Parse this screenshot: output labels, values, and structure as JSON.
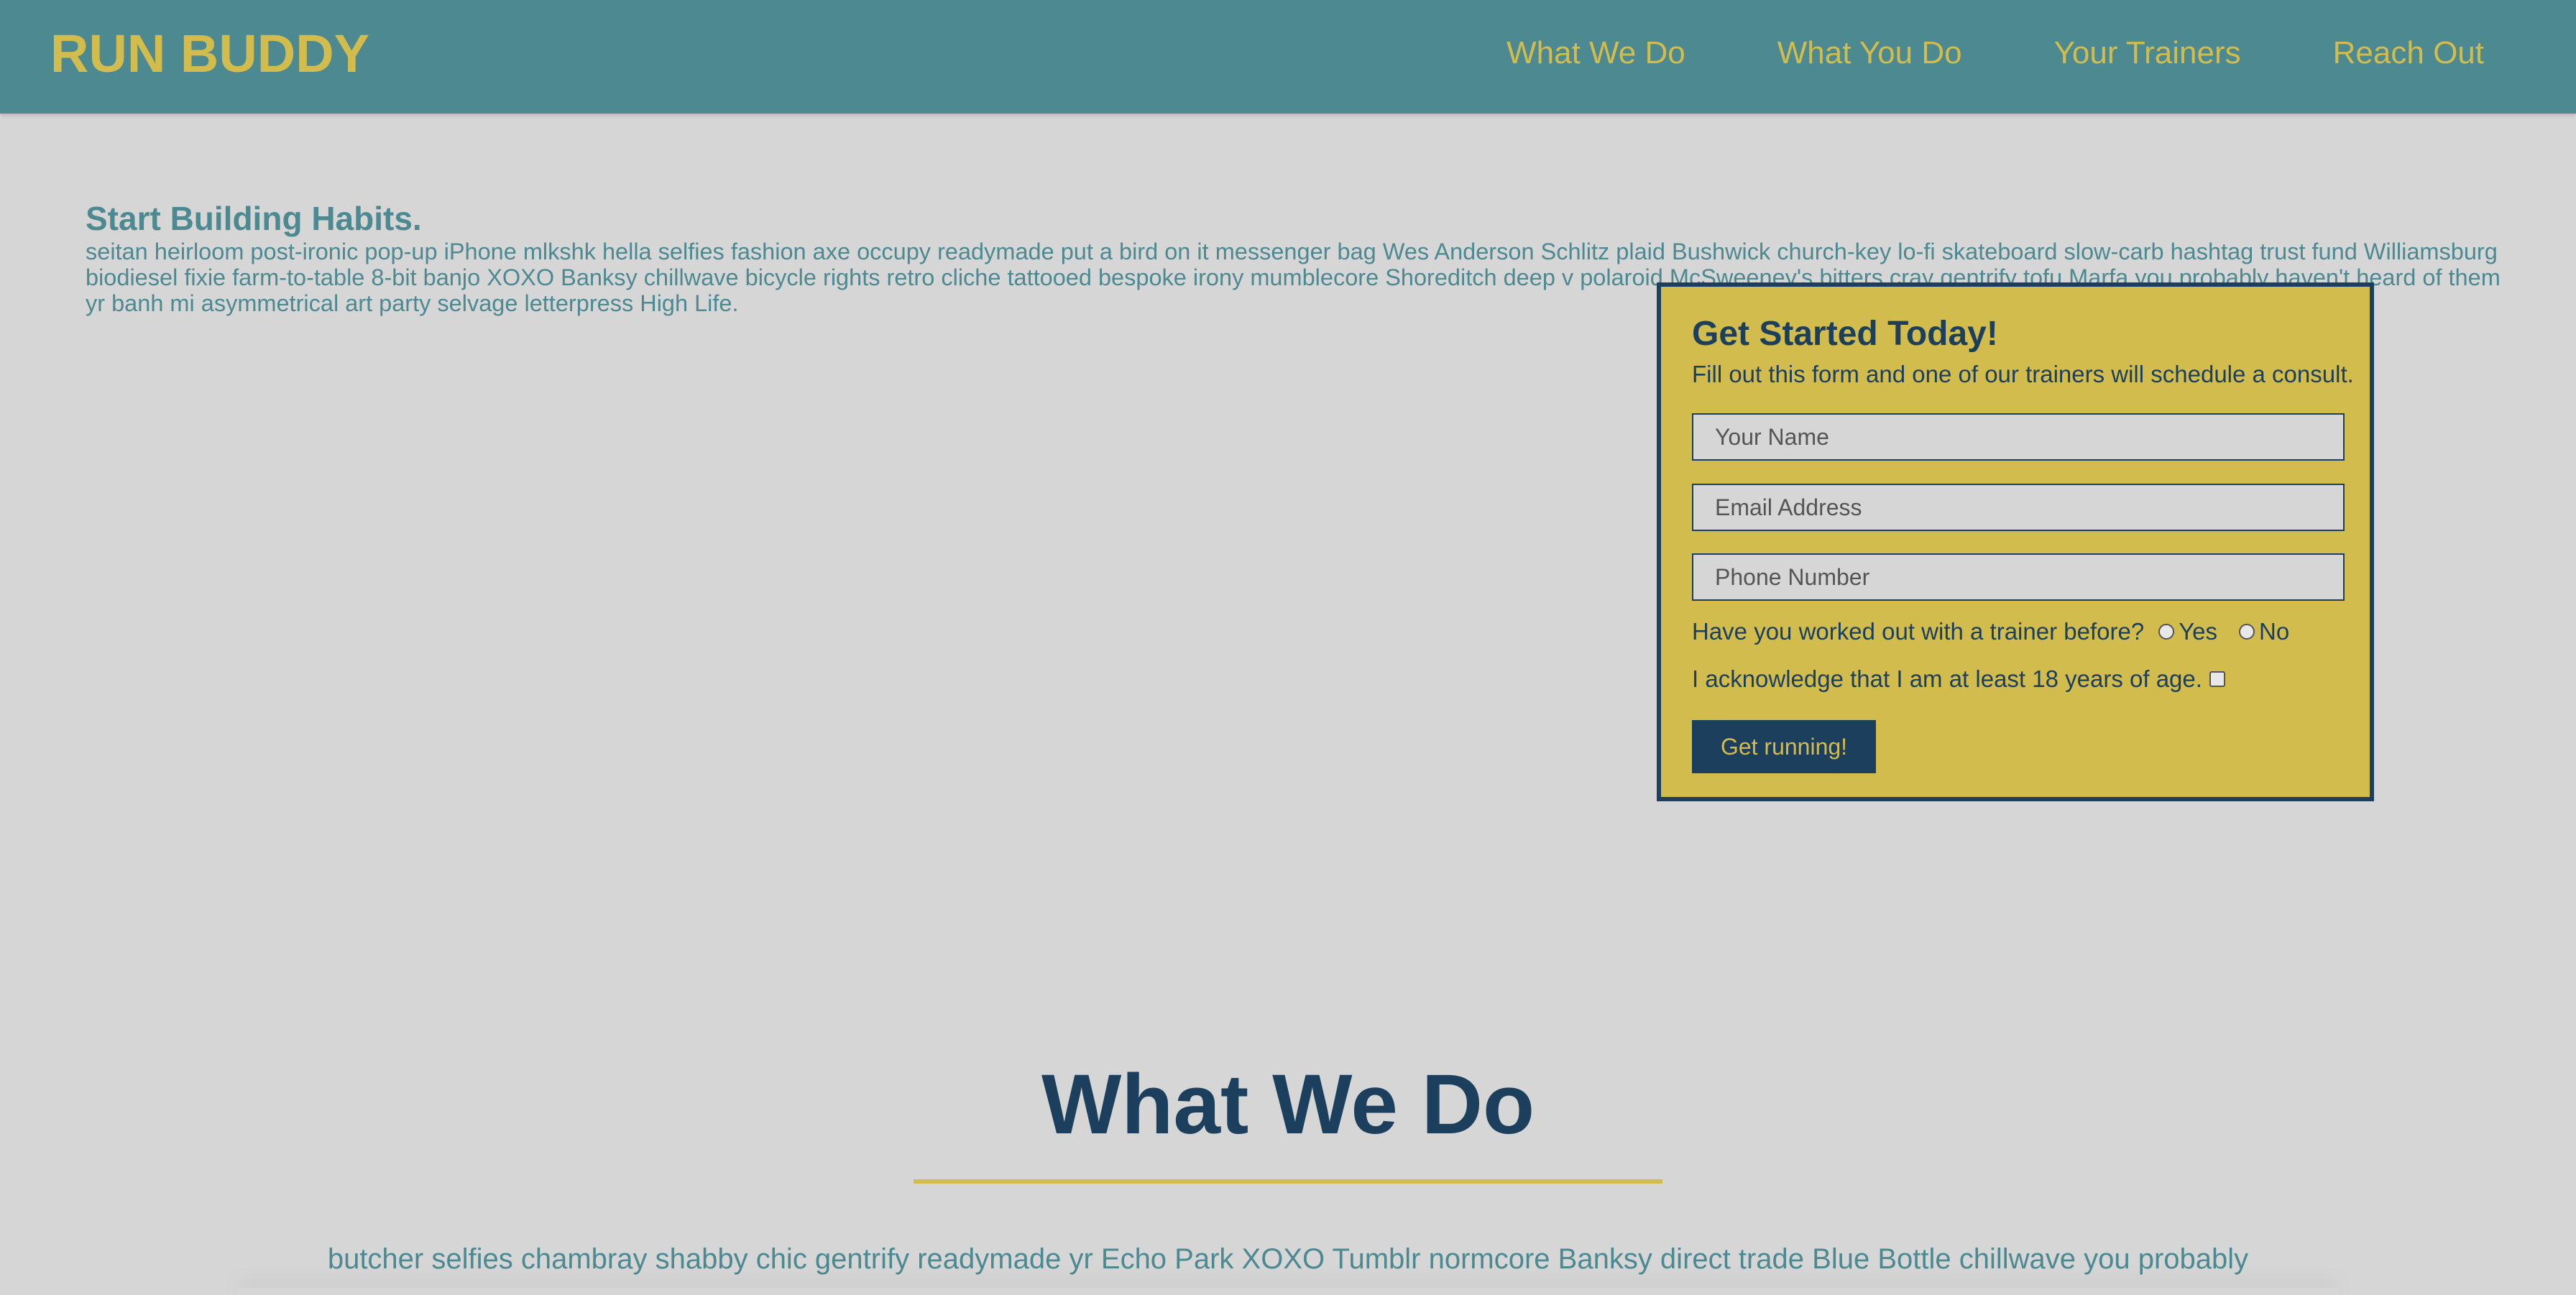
{
  "header": {
    "logo": "RUN BUDDY",
    "nav": [
      {
        "label": "What We Do"
      },
      {
        "label": "What You Do"
      },
      {
        "label": "Your Trainers"
      },
      {
        "label": "Reach Out"
      }
    ]
  },
  "hero": {
    "title": "Start Building Habits.",
    "text": "seitan heirloom post-ironic pop-up iPhone mlkshk hella selfies fashion axe occupy readymade put a bird on it messenger bag Wes Anderson Schlitz plaid Bushwick church-key lo-fi skateboard slow-carb hashtag trust fund Williamsburg biodiesel fixie farm-to-table 8-bit banjo XOXO Banksy chillwave bicycle rights retro cliche tattooed bespoke irony mumblecore Shoreditch deep v polaroid McSweeney's bitters cray gentrify tofu Marfa you probably haven't heard of them yr banh mi asymmetrical art party selvage letterpress High Life."
  },
  "form": {
    "title": "Get Started Today!",
    "subtitle": "Fill out this form and one of our trainers will schedule a consult.",
    "name_placeholder": "Your Name",
    "email_placeholder": "Email Address",
    "phone_placeholder": "Phone Number",
    "trainer_question": "Have you worked out with a trainer before?",
    "yes_label": "Yes",
    "no_label": "No",
    "age_ack": "I acknowledge that I am at least 18 years of age.",
    "submit_label": "Get running!"
  },
  "what_we_do": {
    "title": "What We Do",
    "text": "butcher selfies chambray shabby chic gentrify readymade yr Echo Park XOXO Tumblr normcore Banksy direct trade Blue Bottle chillwave you probably"
  },
  "colors": {
    "header_bg": "#4c8991",
    "accent_yellow": "#d1bc4d",
    "navy": "#1c3f5e",
    "page_bg": "#d6d6d6"
  }
}
